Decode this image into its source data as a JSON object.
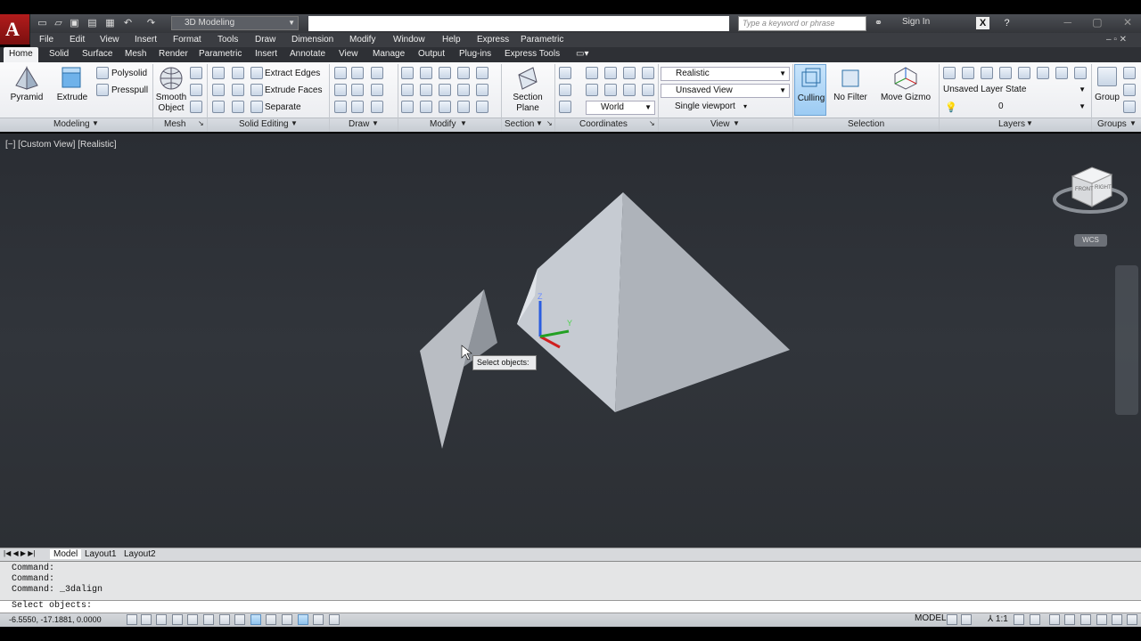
{
  "app": {
    "workspace": "3D Modeling",
    "search_placeholder": "Type a keyword or phrase",
    "sign_in": "Sign In"
  },
  "menu": [
    "File",
    "Edit",
    "View",
    "Insert",
    "Format",
    "Tools",
    "Draw",
    "Dimension",
    "Modify",
    "Window",
    "Help",
    "Express",
    "Parametric"
  ],
  "tabs": [
    "Home",
    "Solid",
    "Surface",
    "Mesh",
    "Render",
    "Parametric",
    "Insert",
    "Annotate",
    "View",
    "Manage",
    "Output",
    "Plug-ins",
    "Express Tools"
  ],
  "ribbon": {
    "modeling": {
      "pyramid": "Pyramid",
      "extrude": "Extrude",
      "polysolid": "Polysolid",
      "presspull": "Presspull",
      "title": "Modeling"
    },
    "mesh": {
      "smooth_object": "Smooth Object",
      "title": "Mesh"
    },
    "solid_editing": {
      "extract_edges": "Extract Edges",
      "extrude_faces": "Extrude Faces",
      "separate": "Separate",
      "title": "Solid Editing"
    },
    "draw": {
      "title": "Draw"
    },
    "modify": {
      "title": "Modify"
    },
    "section": {
      "section_plane": "Section Plane",
      "title": "Section"
    },
    "coordinates": {
      "world": "World",
      "title": "Coordinates"
    },
    "view": {
      "visual_style": "Realistic",
      "named_view": "Unsaved View",
      "viewport": "Single viewport",
      "title": "View"
    },
    "selection": {
      "culling": "Culling",
      "no_filter": "No Filter",
      "move_gizmo": "Move Gizmo",
      "title": "Selection"
    },
    "layers": {
      "layer_state": "Unsaved Layer State",
      "current_layer": "0",
      "title": "Layers"
    },
    "groups": {
      "group": "Group",
      "title": "Groups"
    }
  },
  "viewport": {
    "label": "[−] [Custom View] [Realistic]",
    "tooltip": "Select objects:",
    "viewcube_faces": [
      "FRONT",
      "RIGHT"
    ],
    "wcs": "WCS"
  },
  "layout_tabs": [
    "Model",
    "Layout1",
    "Layout2"
  ],
  "command": {
    "history": [
      "Command:",
      "Command:",
      "Command: _3dalign"
    ],
    "prompt": "Select objects:"
  },
  "status": {
    "coords": "-6.5550, -17.1881, 0.0000",
    "model": "MODEL",
    "scale": "1:1"
  },
  "colors": {
    "accent": "#9ccbf3",
    "viewport_bg": "#2c2f34"
  }
}
